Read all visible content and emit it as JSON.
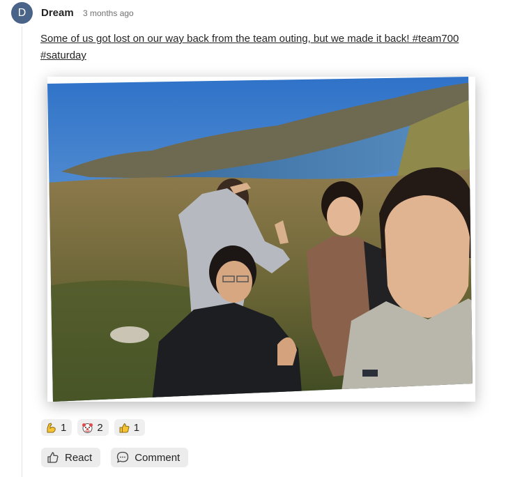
{
  "post": {
    "author_initial": "D",
    "author_name": "Dream",
    "timestamp": "3 months ago",
    "text": "Some of us got lost on our way back from the team outing, but we made it back! #team700 #saturday"
  },
  "photo": {
    "alt": "Four people taking a selfie on a hilltop above a lake"
  },
  "reactions": [
    {
      "icon": "flexed-biceps-icon",
      "count": "1"
    },
    {
      "icon": "clown-face-icon",
      "count": "2"
    },
    {
      "icon": "thumbs-up-icon",
      "count": "1"
    }
  ],
  "actions": {
    "react_label": "React",
    "comment_label": "Comment"
  },
  "colors": {
    "avatar_bg": "#4a6388",
    "pill_bg": "#efefef",
    "text": "#242424",
    "muted": "#707070"
  }
}
